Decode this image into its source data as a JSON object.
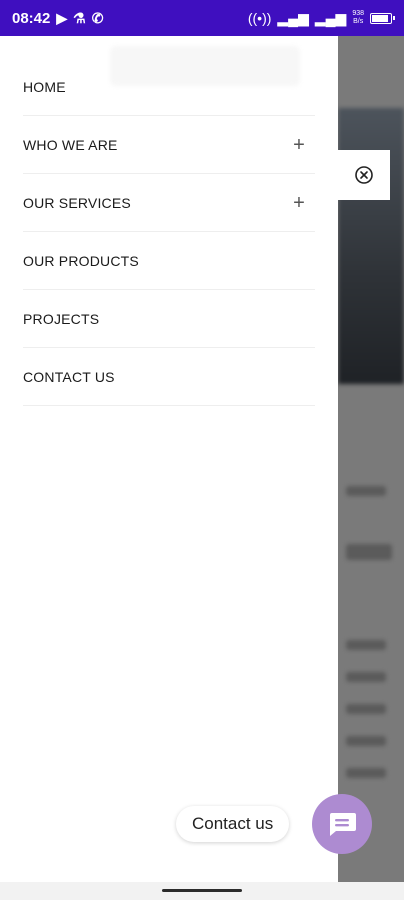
{
  "status_bar": {
    "time": "08:42",
    "net_speed_value": "938",
    "net_speed_unit": "B/s",
    "left_icons": [
      "play-icon",
      "flask-icon",
      "whatsapp-icon"
    ],
    "right_icons": [
      "hotspot-icon",
      "signal-icon",
      "wifi-signal-icon",
      "battery-icon"
    ]
  },
  "drawer": {
    "menu": [
      {
        "label": "HOME",
        "expandable": false
      },
      {
        "label": "WHO WE ARE",
        "expandable": true
      },
      {
        "label": "OUR SERVICES",
        "expandable": true
      },
      {
        "label": "OUR PRODUCTS",
        "expandable": false
      },
      {
        "label": "PROJECTS",
        "expandable": false
      },
      {
        "label": "CONTACT US",
        "expandable": false
      }
    ]
  },
  "contact_widget": {
    "label": "Contact us"
  },
  "colors": {
    "status_bar": "#3f0fbf",
    "fab": "#ad8bd1",
    "overlay": "#7a7a7a"
  }
}
